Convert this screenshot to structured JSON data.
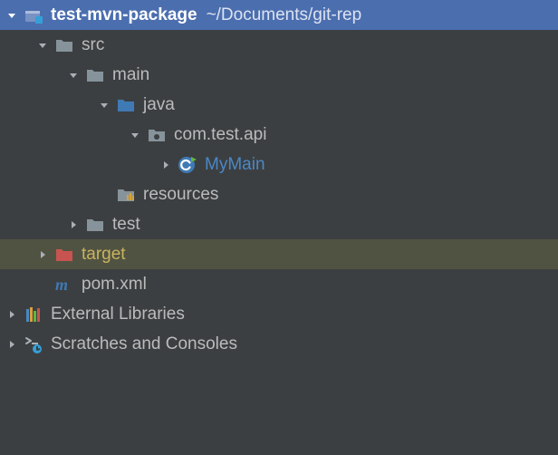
{
  "tree": {
    "root": {
      "name": "test-mvn-package",
      "path": "~/Documents/git-rep"
    },
    "src": "src",
    "main": "main",
    "java": "java",
    "pkg": "com.test.api",
    "cls": "MyMain",
    "resources": "resources",
    "test": "test",
    "target": "target",
    "pom": "pom.xml",
    "ext": "External Libraries",
    "scratch": "Scratches and Consoles"
  }
}
